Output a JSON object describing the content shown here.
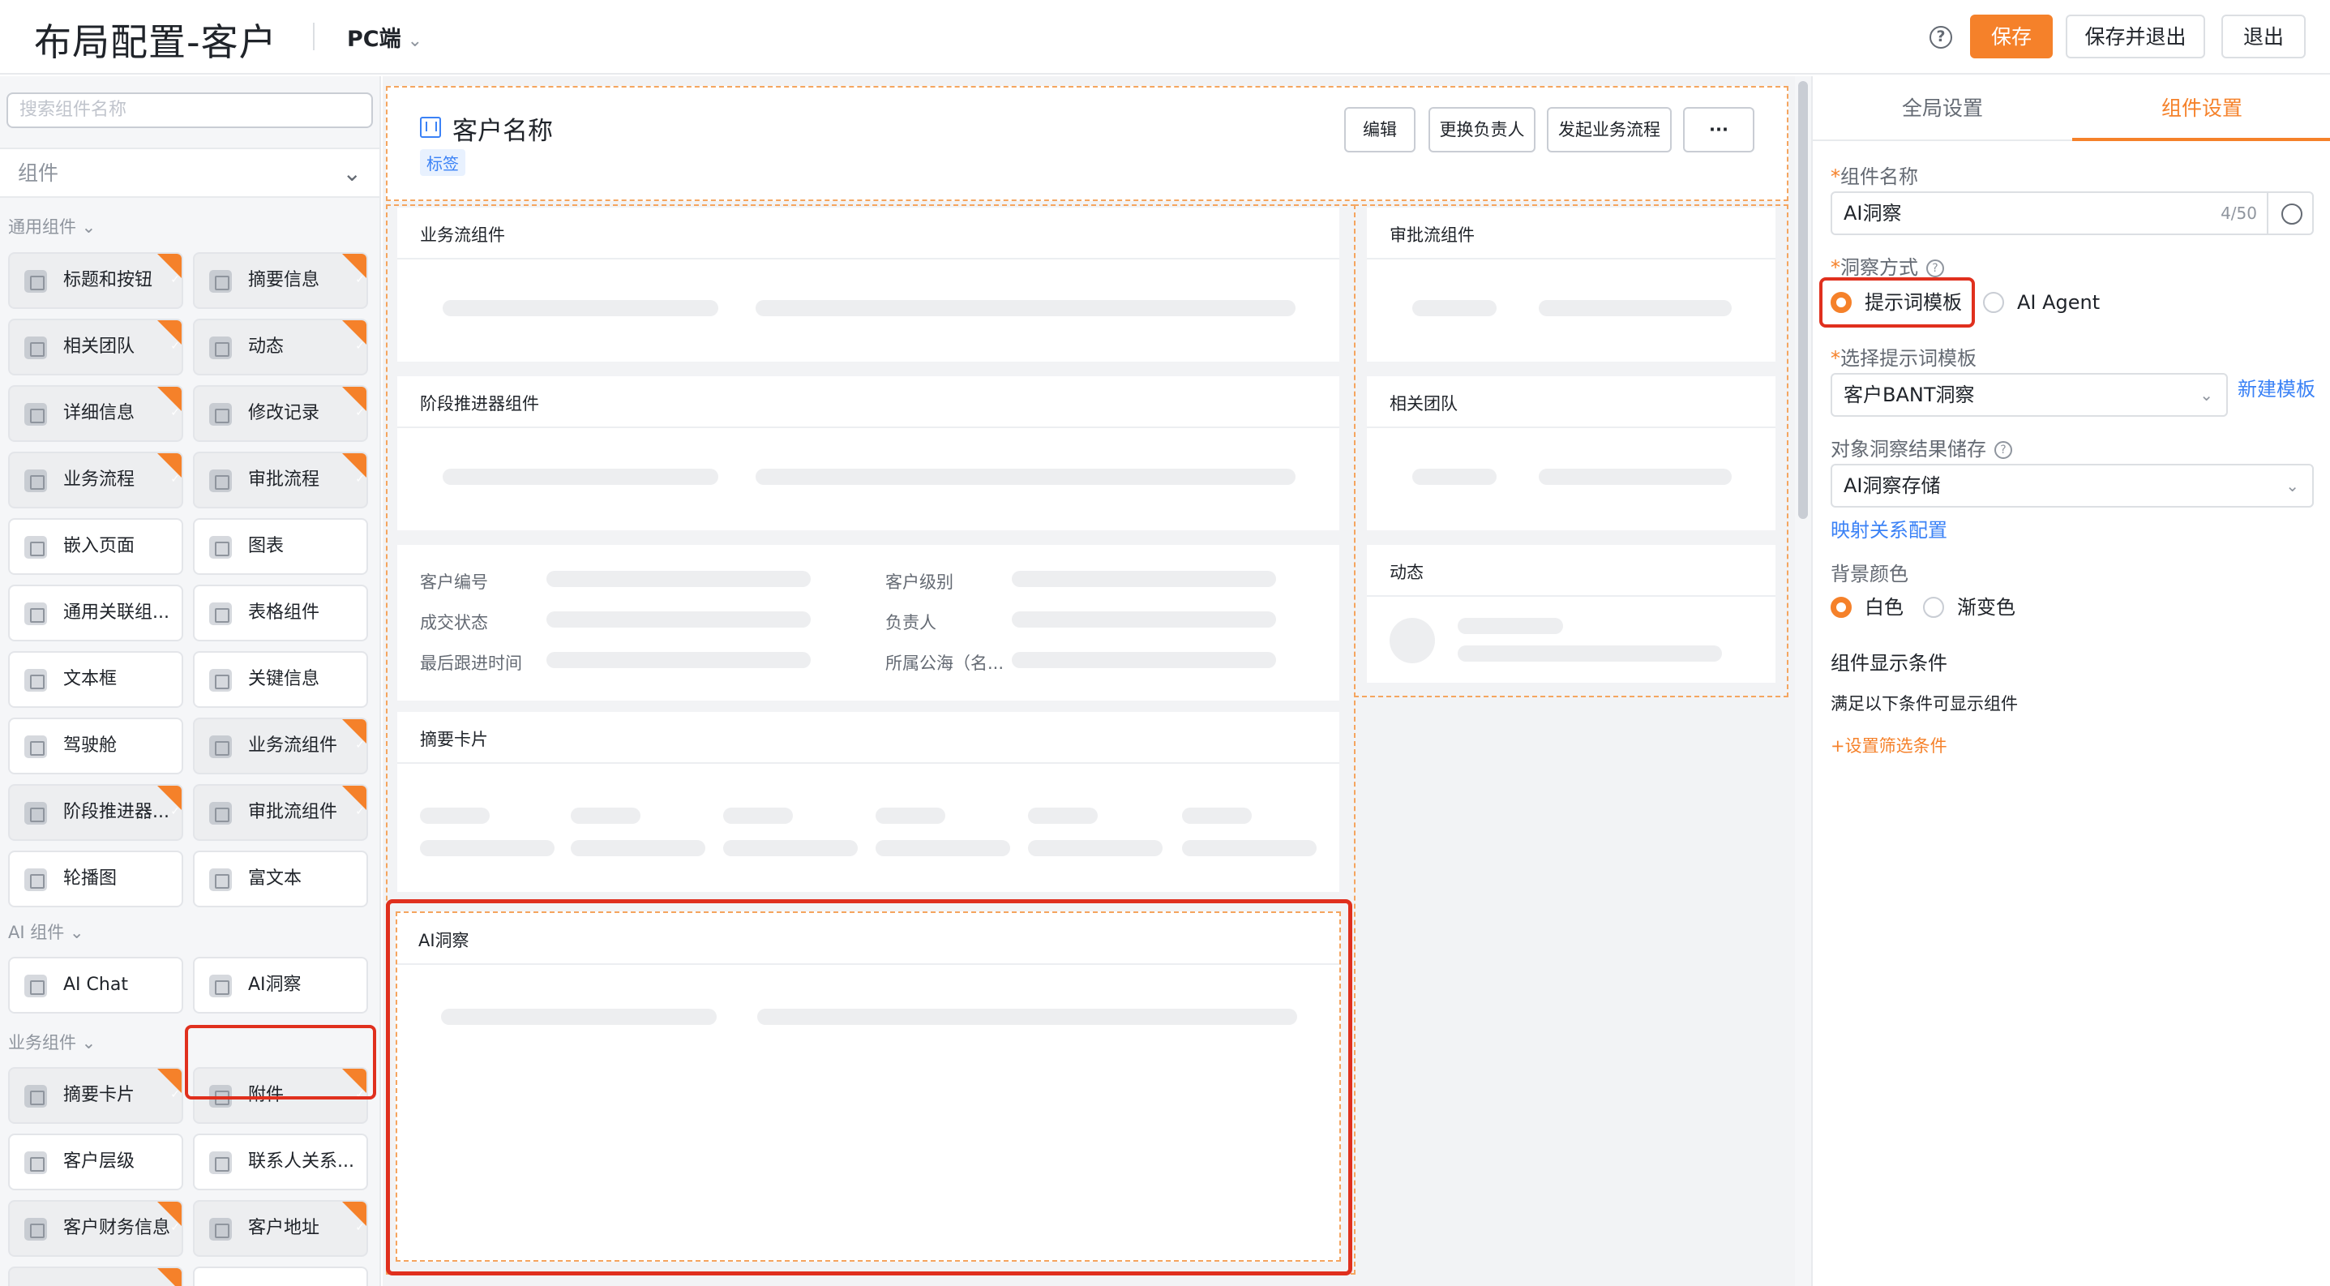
{
  "header": {
    "title": "布局配置-客户",
    "platform": "PC端",
    "help_icon": "?",
    "save": "保存",
    "save_exit": "保存并退出",
    "exit": "退出"
  },
  "left": {
    "search_placeholder": "搜索组件名称",
    "category": "组件",
    "groups": {
      "common": "通用组件",
      "ai": "AI 组件",
      "business": "业务组件"
    },
    "items": [
      "标题和按钮",
      "摘要信息",
      "相关团队",
      "动态",
      "详细信息",
      "修改记录",
      "业务流程",
      "审批流程",
      "嵌入页面",
      "图表",
      "通用关联组...",
      "表格组件",
      "文本框",
      "关键信息",
      "驾驶舱",
      "业务流组件",
      "阶段推进器...",
      "审批流组件",
      "轮播图",
      "富文本"
    ],
    "ai_items": [
      "AI Chat",
      "AI洞察"
    ],
    "business_items": [
      "摘要卡片",
      "附件",
      "客户层级",
      "联系人关系...",
      "客户财务信息",
      "客户地址"
    ]
  },
  "canvas": {
    "record_name": "客户名称",
    "tag": "标签",
    "buttons": [
      "编辑",
      "更换负责人",
      "发起业务流程",
      "···"
    ],
    "cards": {
      "bizflow": "业务流组件",
      "stage": "阶段推进器组件",
      "summary": "摘要卡片",
      "ai": "AI洞察",
      "approval": "审批流组件",
      "team": "相关团队",
      "activity": "动态"
    },
    "fields": [
      "客户编号",
      "客户级别",
      "成交状态",
      "负责人",
      "最后跟进时间",
      "所属公海（名..."
    ]
  },
  "right": {
    "tabs": [
      "全局设置",
      "组件设置"
    ],
    "name_label": "组件名称",
    "name_value": "AI洞察",
    "name_counter": "4/50",
    "mode_label": "洞察方式",
    "mode_options": [
      "提示词模板",
      "AI Agent"
    ],
    "template_label": "选择提示词模板",
    "template_value": "客户BANT洞察",
    "new_template": "新建模板",
    "storage_label": "对象洞察结果储存",
    "storage_value": "AI洞察存储",
    "mapping_link": "映射关系配置",
    "bg_label": "背景颜色",
    "bg_options": [
      "白色",
      "渐变色"
    ],
    "cond_title": "组件显示条件",
    "cond_desc": "满足以下条件可显示组件",
    "cond_add": "+设置筛选条件"
  }
}
